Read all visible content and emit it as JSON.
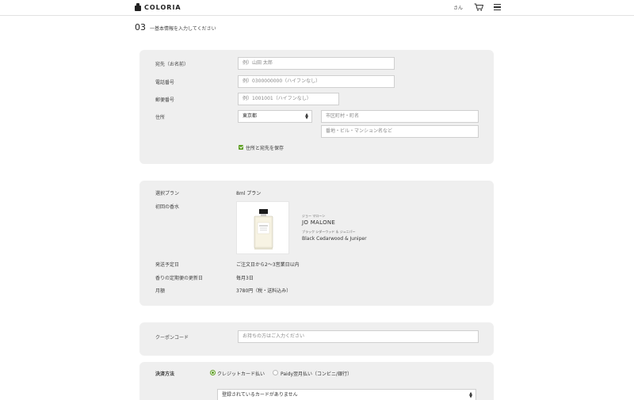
{
  "header": {
    "logo_text": "COLORIA",
    "user_name": "さん"
  },
  "step": {
    "number": "03",
    "label": "一基本情報を入力してください"
  },
  "address_form": {
    "name_label": "宛先（お名前）",
    "name_placeholder": "例）山田 太郎",
    "phone_label": "電話番号",
    "phone_placeholder": "例）0300000000（ハイフンなし）",
    "postal_label": "郵便番号",
    "postal_placeholder": "例）1001001（ハイフンなし）",
    "address_label": "住所",
    "prefecture_value": "東京都",
    "city_placeholder": "市区町村・町名",
    "street_placeholder": "番地・ビル・マンション名など",
    "save_checkbox_label": "住所と宛先を保存"
  },
  "order_summary": {
    "plan_label": "選択プラン",
    "plan_value": "8ml プラン",
    "first_scent_label": "初回の香水",
    "product_brand_kana": "ジョー マローン",
    "product_brand": "JO MALONE",
    "product_name_kana": "ブラック シダーウッド ＆ ジュニパー",
    "product_name": "Black Cedarwood & Juniper",
    "ship_date_label": "発送予定日",
    "ship_date_value": "ご注文日から2〜3営業日以内",
    "renewal_label": "香りの定期便の更新日",
    "renewal_value": "毎月3日",
    "monthly_label": "月額",
    "monthly_value": "3780円（税・送料込み）"
  },
  "coupon": {
    "label": "クーポンコード",
    "placeholder": "お持ちの方はご入力ください"
  },
  "payment": {
    "label": "決済方法",
    "option_card": "クレジットカード払い",
    "option_paidy": "Paidy翌月払い（コンビニ/銀行）",
    "card_select_value": "登録されているカードがありません"
  },
  "colors": {
    "panel_bg": "#efefef",
    "accent_green": "#5c9e1f"
  }
}
